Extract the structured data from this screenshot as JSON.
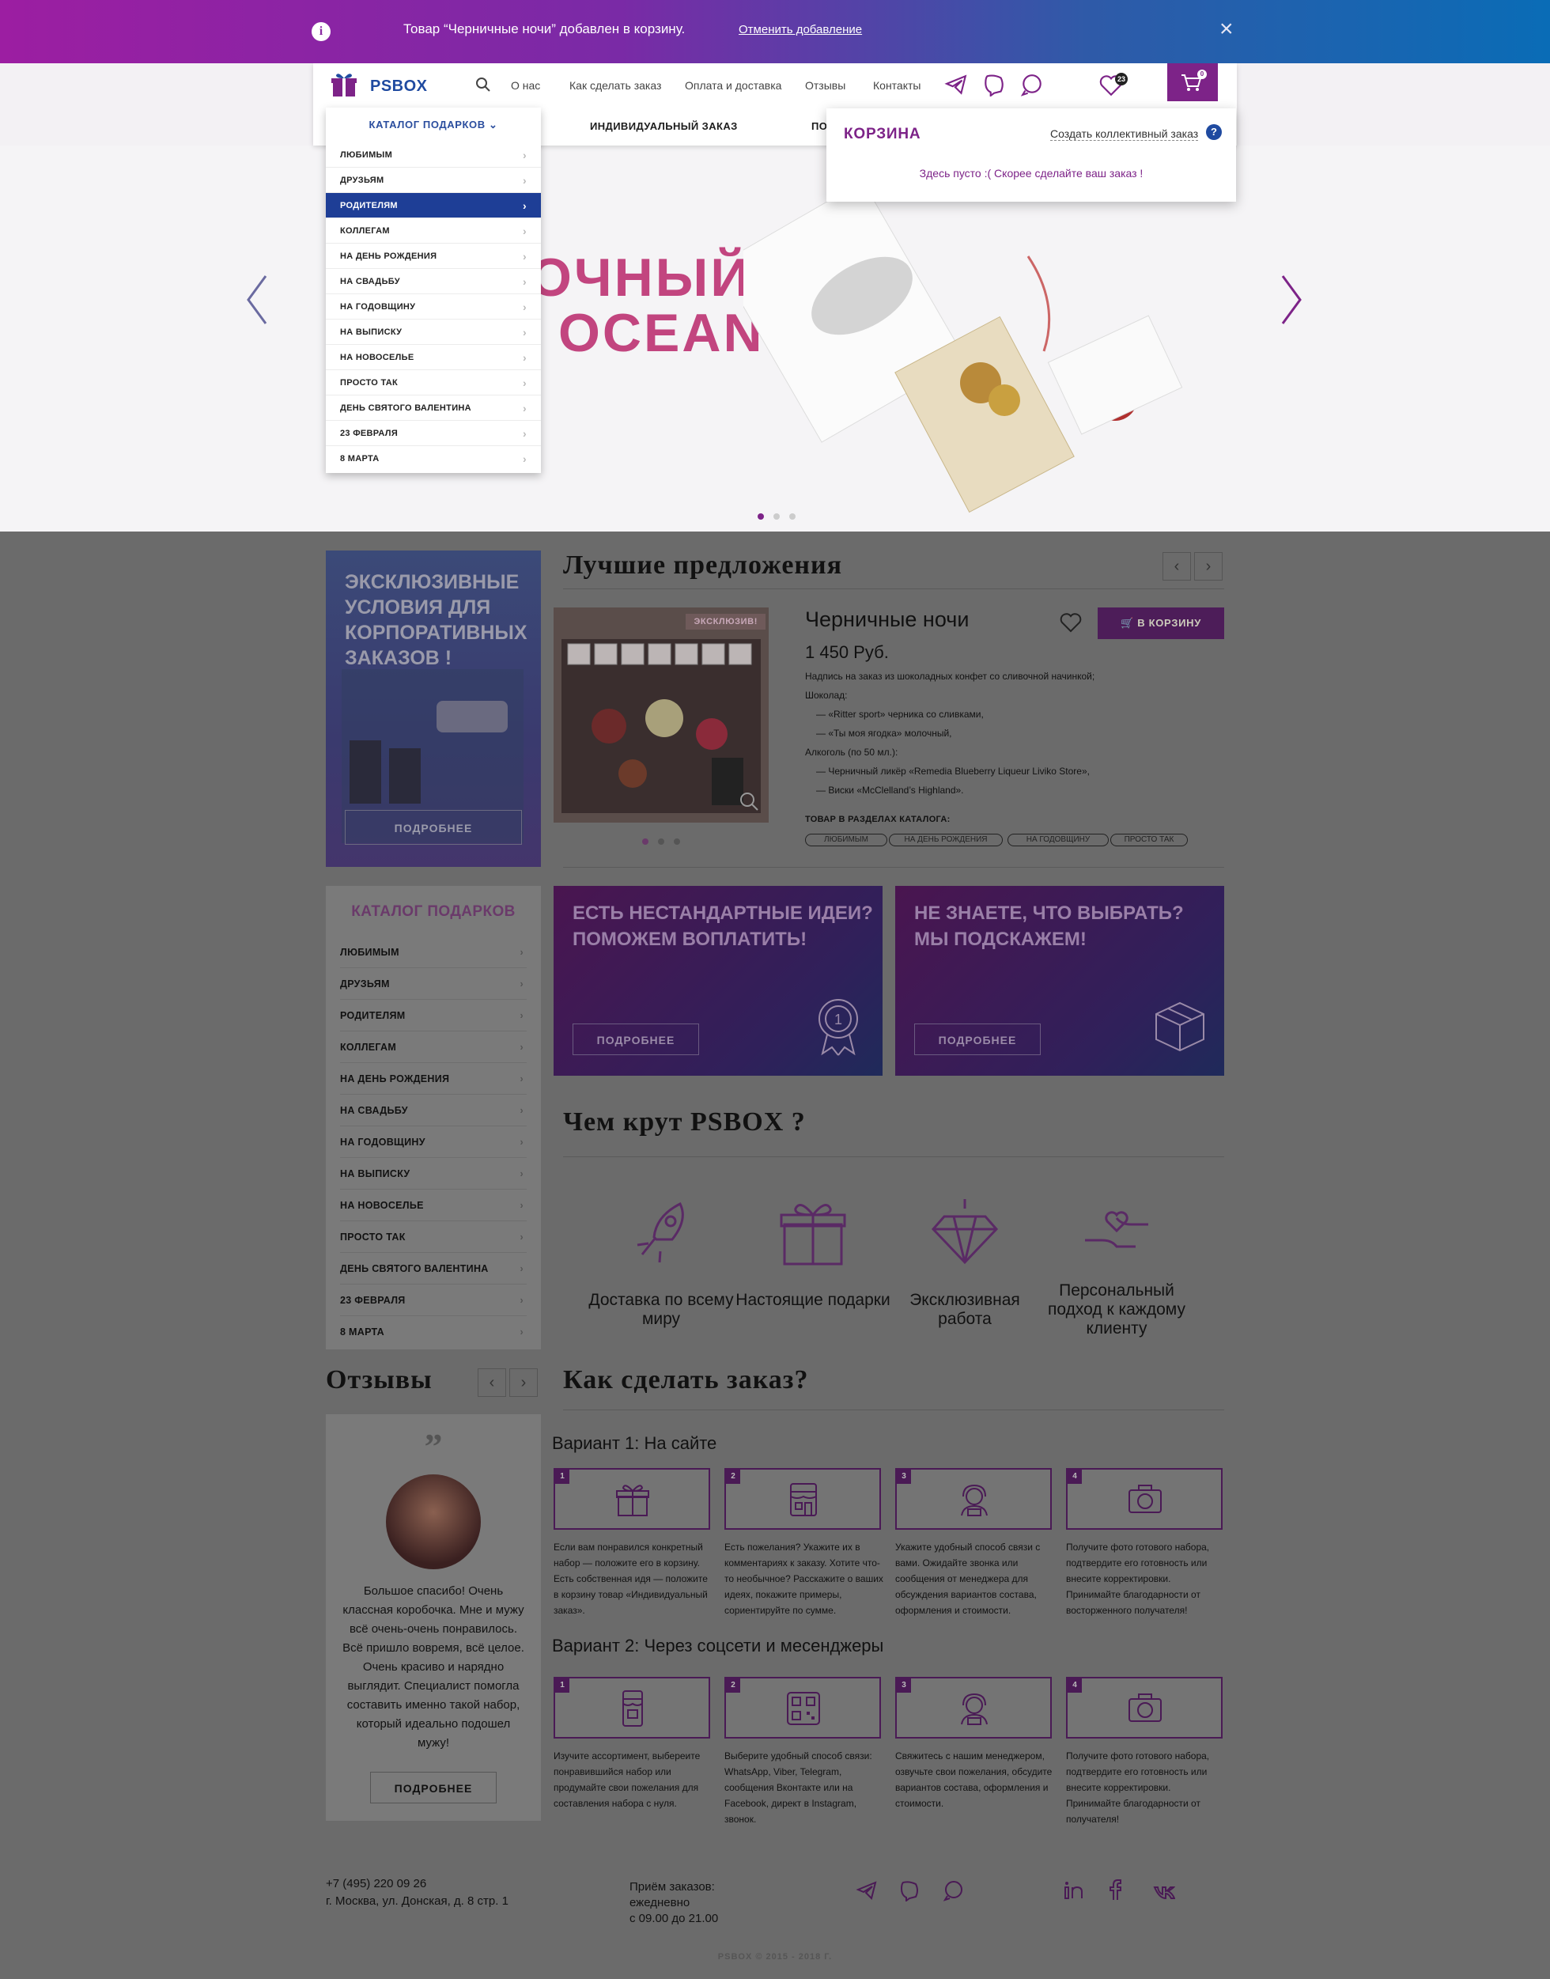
{
  "notification": {
    "icon": "info-icon",
    "message": "Товар “Черничные ночи” добавлен в корзину.",
    "undo_label": "Отменить добавление",
    "close_icon": "close-icon",
    "gradient_colors": [
      "#9c1ea2",
      "#0a6cb6"
    ]
  },
  "header": {
    "logo_text": "PSBOX",
    "nav": [
      "О нас",
      "Как сделать заказ",
      "Оплата и доставка",
      "Отзывы",
      "Контакты"
    ],
    "favorites_count": "23",
    "cart_count": "0",
    "subnav": [
      "Каталог подарков",
      "Индивидуальный заказ",
      "По"
    ],
    "accent_color": "#7d2388"
  },
  "dropdown": {
    "title": "Каталог подарков",
    "items": [
      "Любимым",
      "Друзьям",
      "Родителям",
      "Коллегам",
      "На день рождения",
      "На свадьбу",
      "На годовщину",
      "На выписку",
      "На новоселье",
      "Просто так",
      "День святого Валентина",
      "23 февраля",
      "8 марта"
    ],
    "active_index": 2
  },
  "cart_popup": {
    "title": "Корзина",
    "collective_label": "Создать коллективный заказ",
    "help": "?",
    "empty_text": "Здесь пусто :( Скорее сделайте ваш заказ !"
  },
  "hero": {
    "line1": "ОЧНЫЙ",
    "line2": "OCEAN",
    "slides": 3,
    "active_slide": 1
  },
  "corporate": {
    "text": "Эксклюзивные условия для корпоративных заказов !",
    "more": "Подробнее"
  },
  "best": {
    "title": "Лучшие предложения",
    "product": {
      "badge": "Эксклюзив!",
      "name": "Черничные ночи",
      "price": "1 450 Руб.",
      "buy_label": "В корзину",
      "description": [
        "Надпись на заказ из шоколадных конфет со сливочной начинкой;",
        "Шоколад:",
        "— «Ritter sport» черника со сливками,",
        "— «Ты моя ягодка» молочный,",
        "Алкоголь (по 50 мл.):",
        "— Черничный ликёр «Remedia Blueberry Liqueur Liviko Store»,",
        "— Виски «McClelland’s Highland»."
      ],
      "tags_title": "Товар в разделах каталога:",
      "tags": [
        "Любимым",
        "На день рождения",
        "На годовщину",
        "Просто так"
      ]
    },
    "image_dots": 3
  },
  "catalog": {
    "title": "Каталог подарков",
    "items": [
      "Любимым",
      "Друзьям",
      "Родителям",
      "Коллегам",
      "На день рождения",
      "На свадьбу",
      "На годовщину",
      "На выписку",
      "На новоселье",
      "Просто так",
      "День святого Валентина",
      "23 февраля",
      "8 марта"
    ]
  },
  "promos": [
    {
      "text": "Есть нестандартные идеи? Поможем воплатить!",
      "more": "Подробнее",
      "icon": "award-icon"
    },
    {
      "text": "Не знаете, что выбрать? Мы подскажем!",
      "more": "Подробнее",
      "icon": "box-icon"
    }
  ],
  "why": {
    "title": "Чем крут PSBOX ?",
    "features": [
      {
        "text": "Доставка по всему миру",
        "icon": "rocket-icon"
      },
      {
        "text": "Настоящие подарки",
        "icon": "gift-icon"
      },
      {
        "text": "Эксклюзивная работа",
        "icon": "diamond-icon"
      },
      {
        "text": "Персональный подход к каждому клиенту",
        "icon": "heart-hands-icon"
      }
    ]
  },
  "reviews": {
    "title": "Отзывы",
    "quote_mark": "”",
    "text": "Большое спасибо! Очень классная коробочка. Мне и мужу всё очень-очень понравилось. Всё пришло вовремя, всё целое. Очень красиво и нарядно выглядит. Специалист помогла составить именно такой набор, который идеально подошел мужу!",
    "more": "Подробнее"
  },
  "howto": {
    "title": "Как сделать заказ?",
    "variant1": {
      "title": "Вариант 1: На сайте",
      "steps": [
        {
          "n": "1",
          "icon": "gift-icon",
          "text": "Если вам понравился конкретный набор — положите его в корзину. Есть собственная идя — положите в корзину товар «Индивидуальный заказ»."
        },
        {
          "n": "2",
          "icon": "shop-icon",
          "text": "Есть пожелания? Укажите их в комментариях к заказу. Хотите что-то необычное? Расскажите о ваших идеях, покажите примеры, сориентируйте по сумме."
        },
        {
          "n": "3",
          "icon": "operator-icon",
          "text": "Укажите удобный способ связи с вами. Ожидайте звонка или сообщения от менеджера для обсуждения вариантов состава, оформления и стоимости."
        },
        {
          "n": "4",
          "icon": "camera-icon",
          "text": "Получите фото готового набора, подтвердите его готовность или внесите корректировки. Принимайте благодарности от восторженного получателя!"
        }
      ]
    },
    "variant2": {
      "title": "Вариант 2: Через соцсети и месенджеры",
      "steps": [
        {
          "n": "1",
          "icon": "phone-shop-icon",
          "text": "Изучите ассортимент, выбереите понравившийся набор или продумайте свои пожелания для составления набора с нуля."
        },
        {
          "n": "2",
          "icon": "qr-icon",
          "text": "Выберите удобный способ связи: WhatsApp, Viber, Telegram, сообщения Вконтакте или на Facebook, директ в Instagram, звонок."
        },
        {
          "n": "3",
          "icon": "operator-icon",
          "text": "Свяжитесь с нашим менеджером, озвучьте свои пожелания, обсудите вариантов состава, оформления и стоимости."
        },
        {
          "n": "4",
          "icon": "camera-icon",
          "text": "Получите фото готового набора, подтвердите его готовность или внесите корректировки. Принимайте благодарности от получателя!"
        }
      ]
    }
  },
  "footer": {
    "phone": "+7 (495) 220 09 26",
    "address": "г. Москва, ул. Донская, д. 8 стр. 1",
    "hours_title": "Приём заказов:",
    "hours_days": "ежедневно",
    "hours_time": "с 09.00 до 21.00",
    "messengers": [
      "telegram-icon",
      "viber-icon",
      "whatsapp-icon"
    ],
    "socials": [
      "linkedin-icon",
      "facebook-icon",
      "vk-icon"
    ],
    "copyright": "PSBOX © 2015 - 2018 г."
  }
}
